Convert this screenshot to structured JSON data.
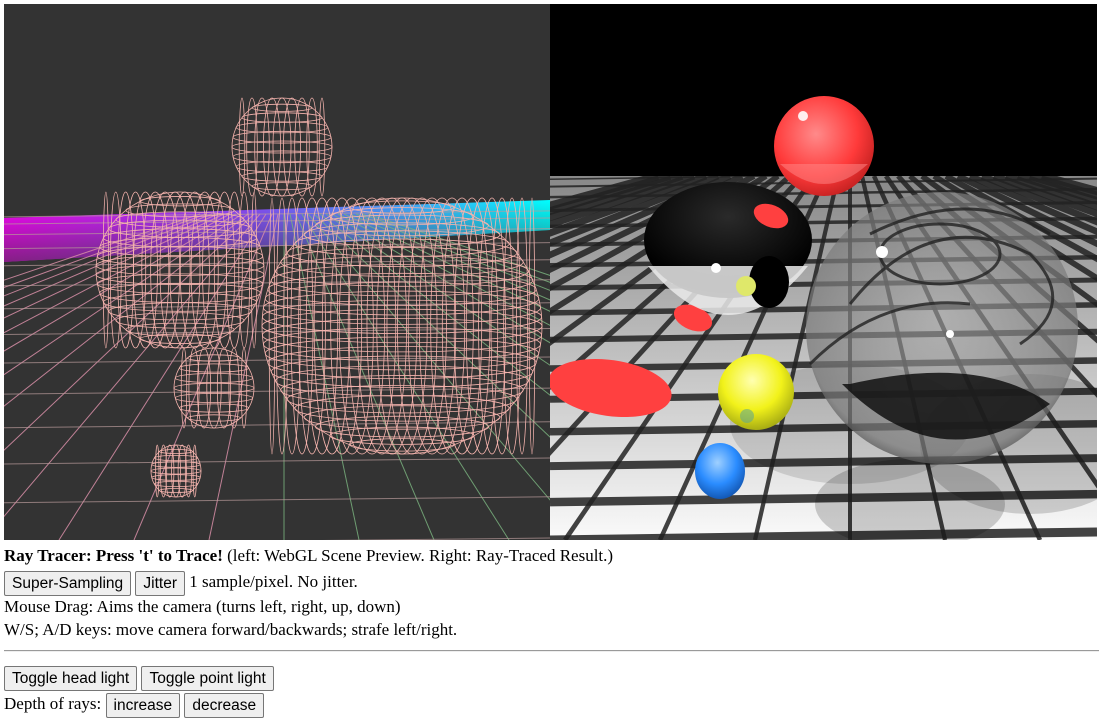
{
  "title_bold": "Ray Tracer: Press 't' to Trace!",
  "title_rest": " (left: WebGL Scene Preview. Right: Ray-Traced Result.)",
  "buttons": {
    "super_sampling": "Super-Sampling",
    "jitter": "Jitter",
    "toggle_head_light": "Toggle head light",
    "toggle_point_light": "Toggle point light",
    "increase": "increase",
    "decrease": "decrease"
  },
  "sample_status": "1 sample/pixel. No jitter.",
  "instructions": {
    "mouse": "Mouse Drag: Aims the camera (turns left, right, up, down)",
    "keys": "W/S; A/D keys: move camera forward/backwards; strafe left/right."
  },
  "depth_label": "Depth of rays: ",
  "colors": {
    "preview_bg": "#333333",
    "wireframe": "#f4b3ad",
    "ground_magenta": "#ff00ff",
    "ground_cyan": "#00ffff",
    "grid_green": "#79b07d",
    "sphere_red": "#ff3a3a",
    "sphere_yellow": "#f2f21a",
    "sphere_blue": "#2a8cff",
    "sky_black": "#000000"
  }
}
